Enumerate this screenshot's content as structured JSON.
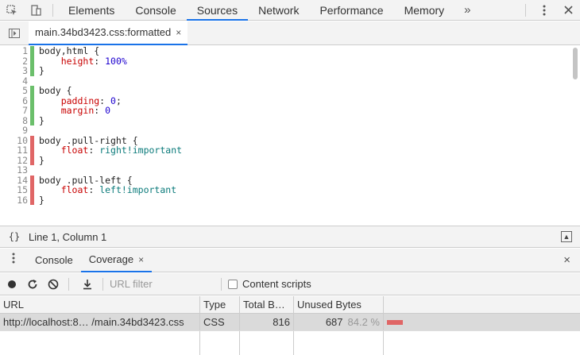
{
  "topbar": {
    "tabs": [
      {
        "label": "Elements",
        "active": false
      },
      {
        "label": "Console",
        "active": false
      },
      {
        "label": "Sources",
        "active": true
      },
      {
        "label": "Network",
        "active": false
      },
      {
        "label": "Performance",
        "active": false
      },
      {
        "label": "Memory",
        "active": false
      }
    ],
    "more_label": "»",
    "icons": [
      "inspect-icon",
      "device-toggle-icon",
      "kebab-menu-icon",
      "close-icon"
    ]
  },
  "filebar": {
    "file_tab_label": "main.34bd3423.css:formatted",
    "close_label": "×"
  },
  "editor": {
    "lines": [
      {
        "num": "1",
        "coverage": "used",
        "tokens": [
          {
            "t": "body,html {",
            "c": ""
          }
        ]
      },
      {
        "num": "2",
        "coverage": "used",
        "tokens": [
          {
            "t": "    ",
            "c": ""
          },
          {
            "t": "height",
            "c": "prop"
          },
          {
            "t": ": ",
            "c": ""
          },
          {
            "t": "100%",
            "c": "num"
          }
        ]
      },
      {
        "num": "3",
        "coverage": "used",
        "tokens": [
          {
            "t": "}",
            "c": ""
          }
        ]
      },
      {
        "num": "4",
        "coverage": "none",
        "tokens": []
      },
      {
        "num": "5",
        "coverage": "used",
        "tokens": [
          {
            "t": "body {",
            "c": ""
          }
        ]
      },
      {
        "num": "6",
        "coverage": "used",
        "tokens": [
          {
            "t": "    ",
            "c": ""
          },
          {
            "t": "padding",
            "c": "prop"
          },
          {
            "t": ": ",
            "c": ""
          },
          {
            "t": "0",
            "c": "num"
          },
          {
            "t": ";",
            "c": ""
          }
        ]
      },
      {
        "num": "7",
        "coverage": "used",
        "tokens": [
          {
            "t": "    ",
            "c": ""
          },
          {
            "t": "margin",
            "c": "prop"
          },
          {
            "t": ": ",
            "c": ""
          },
          {
            "t": "0",
            "c": "num"
          }
        ]
      },
      {
        "num": "8",
        "coverage": "used",
        "tokens": [
          {
            "t": "}",
            "c": ""
          }
        ]
      },
      {
        "num": "9",
        "coverage": "none",
        "tokens": []
      },
      {
        "num": "10",
        "coverage": "unused",
        "tokens": [
          {
            "t": "body .pull-right {",
            "c": ""
          }
        ]
      },
      {
        "num": "11",
        "coverage": "unused",
        "tokens": [
          {
            "t": "    ",
            "c": ""
          },
          {
            "t": "float",
            "c": "prop"
          },
          {
            "t": ": ",
            "c": ""
          },
          {
            "t": "right!important",
            "c": "kw"
          }
        ]
      },
      {
        "num": "12",
        "coverage": "unused",
        "tokens": [
          {
            "t": "}",
            "c": ""
          }
        ]
      },
      {
        "num": "13",
        "coverage": "none",
        "tokens": []
      },
      {
        "num": "14",
        "coverage": "unused",
        "tokens": [
          {
            "t": "body .pull-left {",
            "c": ""
          }
        ]
      },
      {
        "num": "15",
        "coverage": "unused",
        "tokens": [
          {
            "t": "    ",
            "c": ""
          },
          {
            "t": "float",
            "c": "prop"
          },
          {
            "t": ": ",
            "c": ""
          },
          {
            "t": "left!important",
            "c": "kw"
          }
        ]
      },
      {
        "num": "16",
        "coverage": "unused",
        "tokens": [
          {
            "t": "}",
            "c": ""
          }
        ]
      }
    ]
  },
  "statusbar": {
    "braces_label": "{}",
    "position_text": "Line 1, Column 1"
  },
  "drawer": {
    "tabs": [
      {
        "label": "Console",
        "active": false
      },
      {
        "label": "Coverage",
        "active": true
      }
    ],
    "coverage_close_label": "×",
    "close_label": "×"
  },
  "coverage_toolbar": {
    "filter_placeholder": "URL filter",
    "content_scripts_label": "Content scripts",
    "content_scripts_checked": false
  },
  "coverage_table": {
    "headers": {
      "url": "URL",
      "type": "Type",
      "total": "Total B…",
      "unused": "Unused Bytes"
    },
    "rows": [
      {
        "url": "http://localhost:8… /main.34bd3423.css",
        "type": "CSS",
        "total": "816",
        "unused": "687",
        "unused_pct": "84.2 %",
        "unused_fraction": 0.842
      }
    ]
  },
  "colors": {
    "accent": "#1a73e8",
    "coverage_used": "#6bbf6b",
    "coverage_unused": "#e06666"
  }
}
